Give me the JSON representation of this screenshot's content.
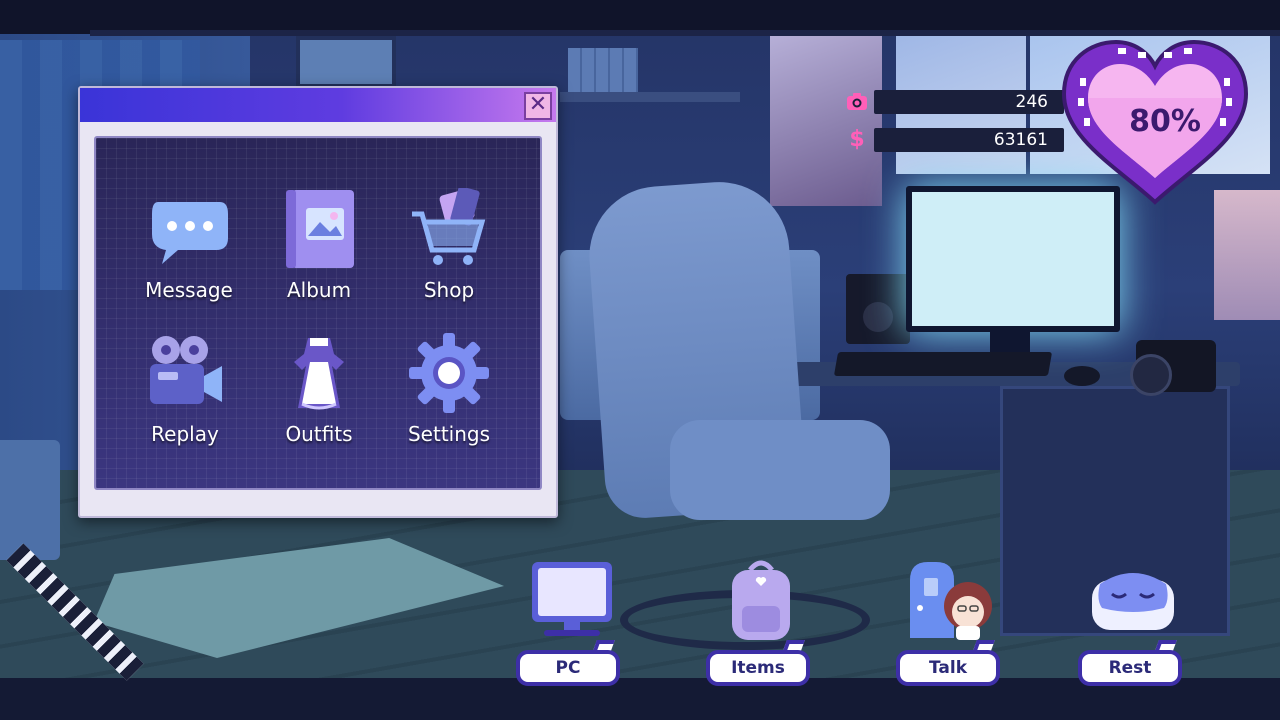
{
  "hud": {
    "photos_icon": "camera-icon",
    "photos_count": "246",
    "money_icon": "dollar-icon",
    "money_symbol": "$",
    "money_amount": "63161",
    "affection_percent": "80%",
    "affection_value": 0.8
  },
  "pc_window": {
    "close_symbol": "✕",
    "apps": [
      {
        "label": "Message",
        "icon": "chat-bubble-icon"
      },
      {
        "label": "Album",
        "icon": "photo-album-icon"
      },
      {
        "label": "Shop",
        "icon": "shopping-cart-icon"
      },
      {
        "label": "Replay",
        "icon": "film-camera-icon"
      },
      {
        "label": "Outfits",
        "icon": "maid-dress-icon"
      },
      {
        "label": "Settings",
        "icon": "gear-icon"
      }
    ]
  },
  "actions": [
    {
      "label": "PC",
      "icon": "computer-monitor-icon"
    },
    {
      "label": "Items",
      "icon": "backpack-icon"
    },
    {
      "label": "Talk",
      "icon": "door-character-icon"
    },
    {
      "label": "Rest",
      "icon": "sleep-mask-icon"
    }
  ],
  "colors": {
    "accent": "#3d2fa7",
    "heart_fill": "#f6b6f0",
    "heart_ring": "#7a2fc9",
    "money_icon": "#ff5fb8"
  }
}
